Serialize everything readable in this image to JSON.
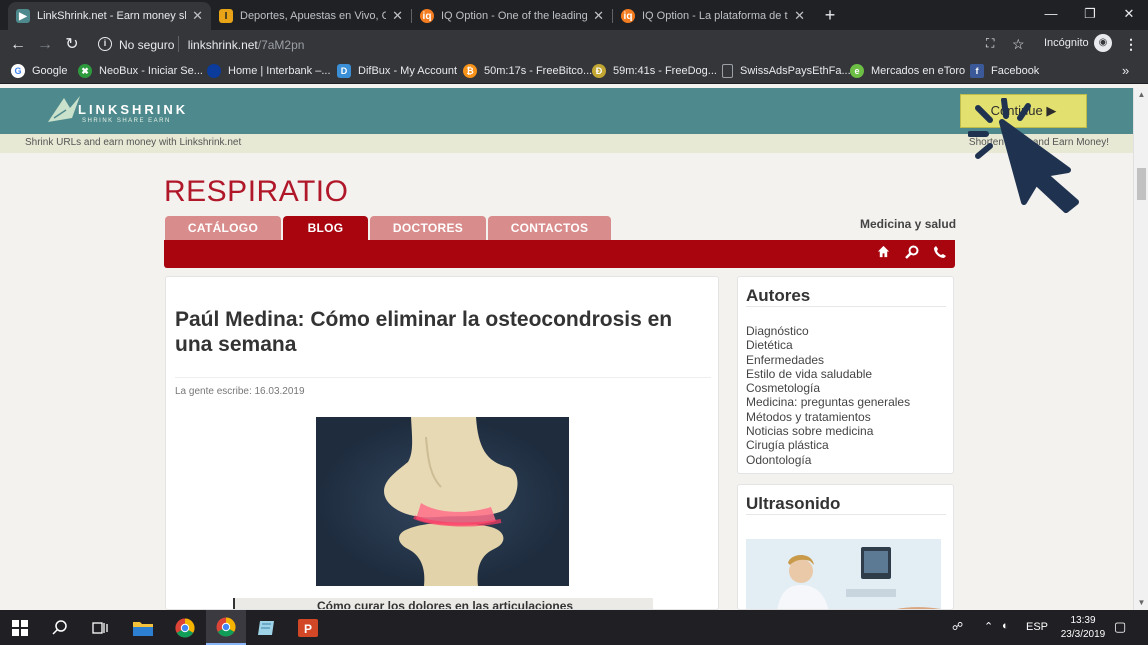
{
  "browser": {
    "tabs": [
      {
        "title": "LinkShrink.net - Earn money sha",
        "active": true,
        "favicon_color": "#4e8a8d"
      },
      {
        "title": "Deportes, Apuestas en Vivo, Casi",
        "active": false,
        "favicon_color": "#e8a317"
      },
      {
        "title": "IQ Option - One of the leading o",
        "active": false,
        "favicon_color": "#f47c20"
      },
      {
        "title": "IQ Option - La plataforma de tra",
        "active": false,
        "favicon_color": "#f47c20"
      }
    ],
    "new_tab_label": "+",
    "security_label": "No seguro",
    "url_host": "linkshrink.net",
    "url_path": "/7aM2pn",
    "incognito_label": "Incógnito",
    "bookmarks": [
      {
        "label": "Google",
        "icon": "google-icon",
        "color": "#4285f4"
      },
      {
        "label": "NeoBux - Iniciar Se...",
        "icon": "neobux-icon",
        "color": "#2e9a3e"
      },
      {
        "label": "Home | Interbank –...",
        "icon": "interbank-icon",
        "color": "#0b3b9b"
      },
      {
        "label": "DifBux - My Account",
        "icon": "difbux-icon",
        "color": "#3a8fd6"
      },
      {
        "label": "50m:17s - FreeBitco...",
        "icon": "freebitco-icon",
        "color": "#f7931a"
      },
      {
        "label": "59m:41s - FreeDog...",
        "icon": "freedoge-icon",
        "color": "#c2a633"
      },
      {
        "label": "SwissAdsPaysEthFa...",
        "icon": "page-icon",
        "color": "#9aa0a6"
      },
      {
        "label": "Mercados en eToro",
        "icon": "etoro-icon",
        "color": "#6cbe45"
      },
      {
        "label": "Facebook",
        "icon": "facebook-icon",
        "color": "#3b5998"
      }
    ]
  },
  "linkshrink": {
    "logo_text": "LINKSHRINK",
    "logo_tagline": "SHRINK  SHARE  EARN",
    "continue_label": "Continue ▶",
    "sub_left": "Shrink URLs and earn money with Linkshrink.net",
    "sub_right": "Shorten Links and Earn Money!"
  },
  "site": {
    "title": "RESPIRATIO",
    "tagline": "Medicina y salud",
    "nav": [
      {
        "label": "CATÁLOGO",
        "active": false
      },
      {
        "label": "BLOG",
        "active": true
      },
      {
        "label": "DOCTORES",
        "active": false
      },
      {
        "label": "CONTACTOS",
        "active": false
      }
    ],
    "article": {
      "title": "Paúl Medina: Cómo eliminar la osteocondrosis en una semana",
      "meta": "La gente escribe: 16.03.2019",
      "caption": "Cómo curar los dolores en las articulaciones"
    },
    "sidebar": {
      "authors_heading": "Autores",
      "categories": [
        "Diagnóstico",
        "Dietética",
        "Enfermedades",
        "Estilo de vida saludable",
        "Cosmetología",
        "Medicina: preguntas generales",
        "Métodos y tratamientos",
        "Noticias sobre medicina",
        "Cirugía plástica",
        "Odontología"
      ],
      "ultrasound_heading": "Ultrasonido"
    }
  },
  "taskbar": {
    "language": "ESP",
    "time": "13:39",
    "date": "23/3/2019"
  },
  "colors": {
    "brand_red": "#a8050f",
    "tab_pink": "#d98c8c",
    "linkshrink_teal": "#4e8a8d",
    "continue_yellow": "#e2e06f"
  }
}
